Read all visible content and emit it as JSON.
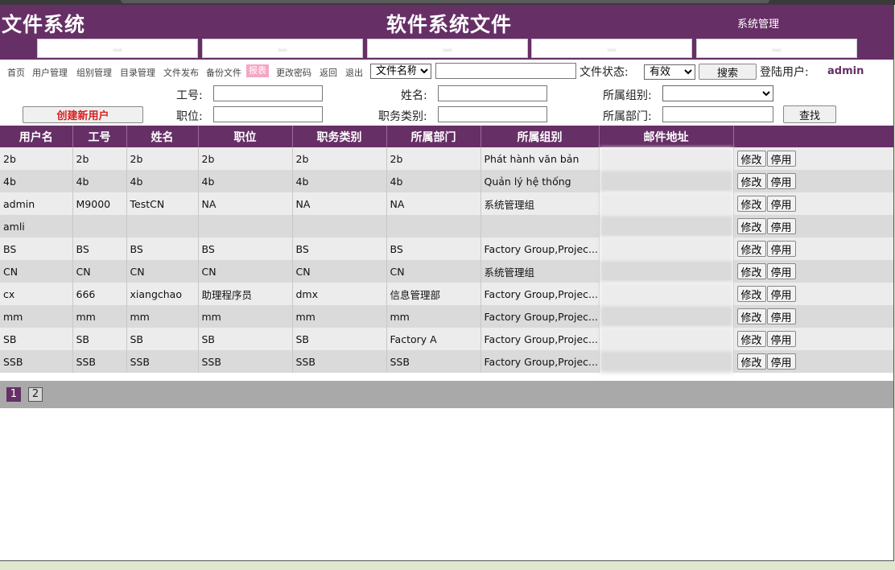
{
  "header": {
    "logo": "文件系统",
    "title": "软件系统文件",
    "admin_link": "系统管理",
    "banners": [
      "…",
      "…",
      "…",
      "…",
      "…"
    ]
  },
  "nav": {
    "links": [
      "首页",
      "用户管理",
      "组别管理",
      "目录管理",
      "文件发布",
      "备份文件",
      "报表",
      "更改密码",
      "返回",
      "退出"
    ],
    "active_index": 6
  },
  "search": {
    "field_select": "文件名称",
    "keyword": "",
    "status_label": "文件状态:",
    "status_select": "有效",
    "search_button": "搜索",
    "login_label": "登陆用户:",
    "login_user": "admin"
  },
  "filter": {
    "create_button": "创建新用户",
    "labels": {
      "emp_no": "工号:",
      "name": "姓名:",
      "group": "所属组别:",
      "position": "职位:",
      "job_type": "职务类别:",
      "dept": "所属部门:"
    },
    "find_button": "查找"
  },
  "table": {
    "columns": [
      "用户名",
      "工号",
      "姓名",
      "职位",
      "职务类别",
      "所属部门",
      "所属组别",
      "邮件地址",
      ""
    ],
    "edit_label": "修改",
    "disable_label": "停用",
    "rows": [
      [
        "2b",
        "2b",
        "2b",
        "2b",
        "2b",
        "2b",
        "Phát hành văn bản",
        ""
      ],
      [
        "4b",
        "4b",
        "4b",
        "4b",
        "4b",
        "4b",
        "Quản lý hệ thống",
        ""
      ],
      [
        "admin",
        "M9000",
        "TestCN",
        "NA",
        "NA",
        "NA",
        "系统管理组",
        ""
      ],
      [
        "amli",
        "",
        "",
        "",
        "",
        "",
        "",
        ""
      ],
      [
        "BS",
        "BS",
        "BS",
        "BS",
        "BS",
        "BS",
        "Factory Group,Projec...",
        ""
      ],
      [
        "CN",
        "CN",
        "CN",
        "CN",
        "CN",
        "CN",
        "系统管理组",
        ""
      ],
      [
        "cx",
        "666",
        "xiangchao",
        "助理程序员",
        "dmx",
        "信息管理部",
        "Factory Group,Projec...",
        ""
      ],
      [
        "mm",
        "mm",
        "mm",
        "mm",
        "mm",
        "mm",
        "Factory Group,Projec...",
        ""
      ],
      [
        "SB",
        "SB",
        "SB",
        "SB",
        "SB",
        "Factory A",
        "Factory Group,Projec...",
        ""
      ],
      [
        "SSB",
        "SSB",
        "SSB",
        "SSB",
        "SSB",
        "SSB",
        "Factory Group,Projec...",
        ""
      ]
    ]
  },
  "pager": {
    "pages": [
      "1",
      "2"
    ],
    "current": "1"
  },
  "colors": {
    "brand": "#662f66",
    "row_odd": "#ececec",
    "row_even": "#dadada",
    "pager_bg": "#a9a9a9"
  }
}
